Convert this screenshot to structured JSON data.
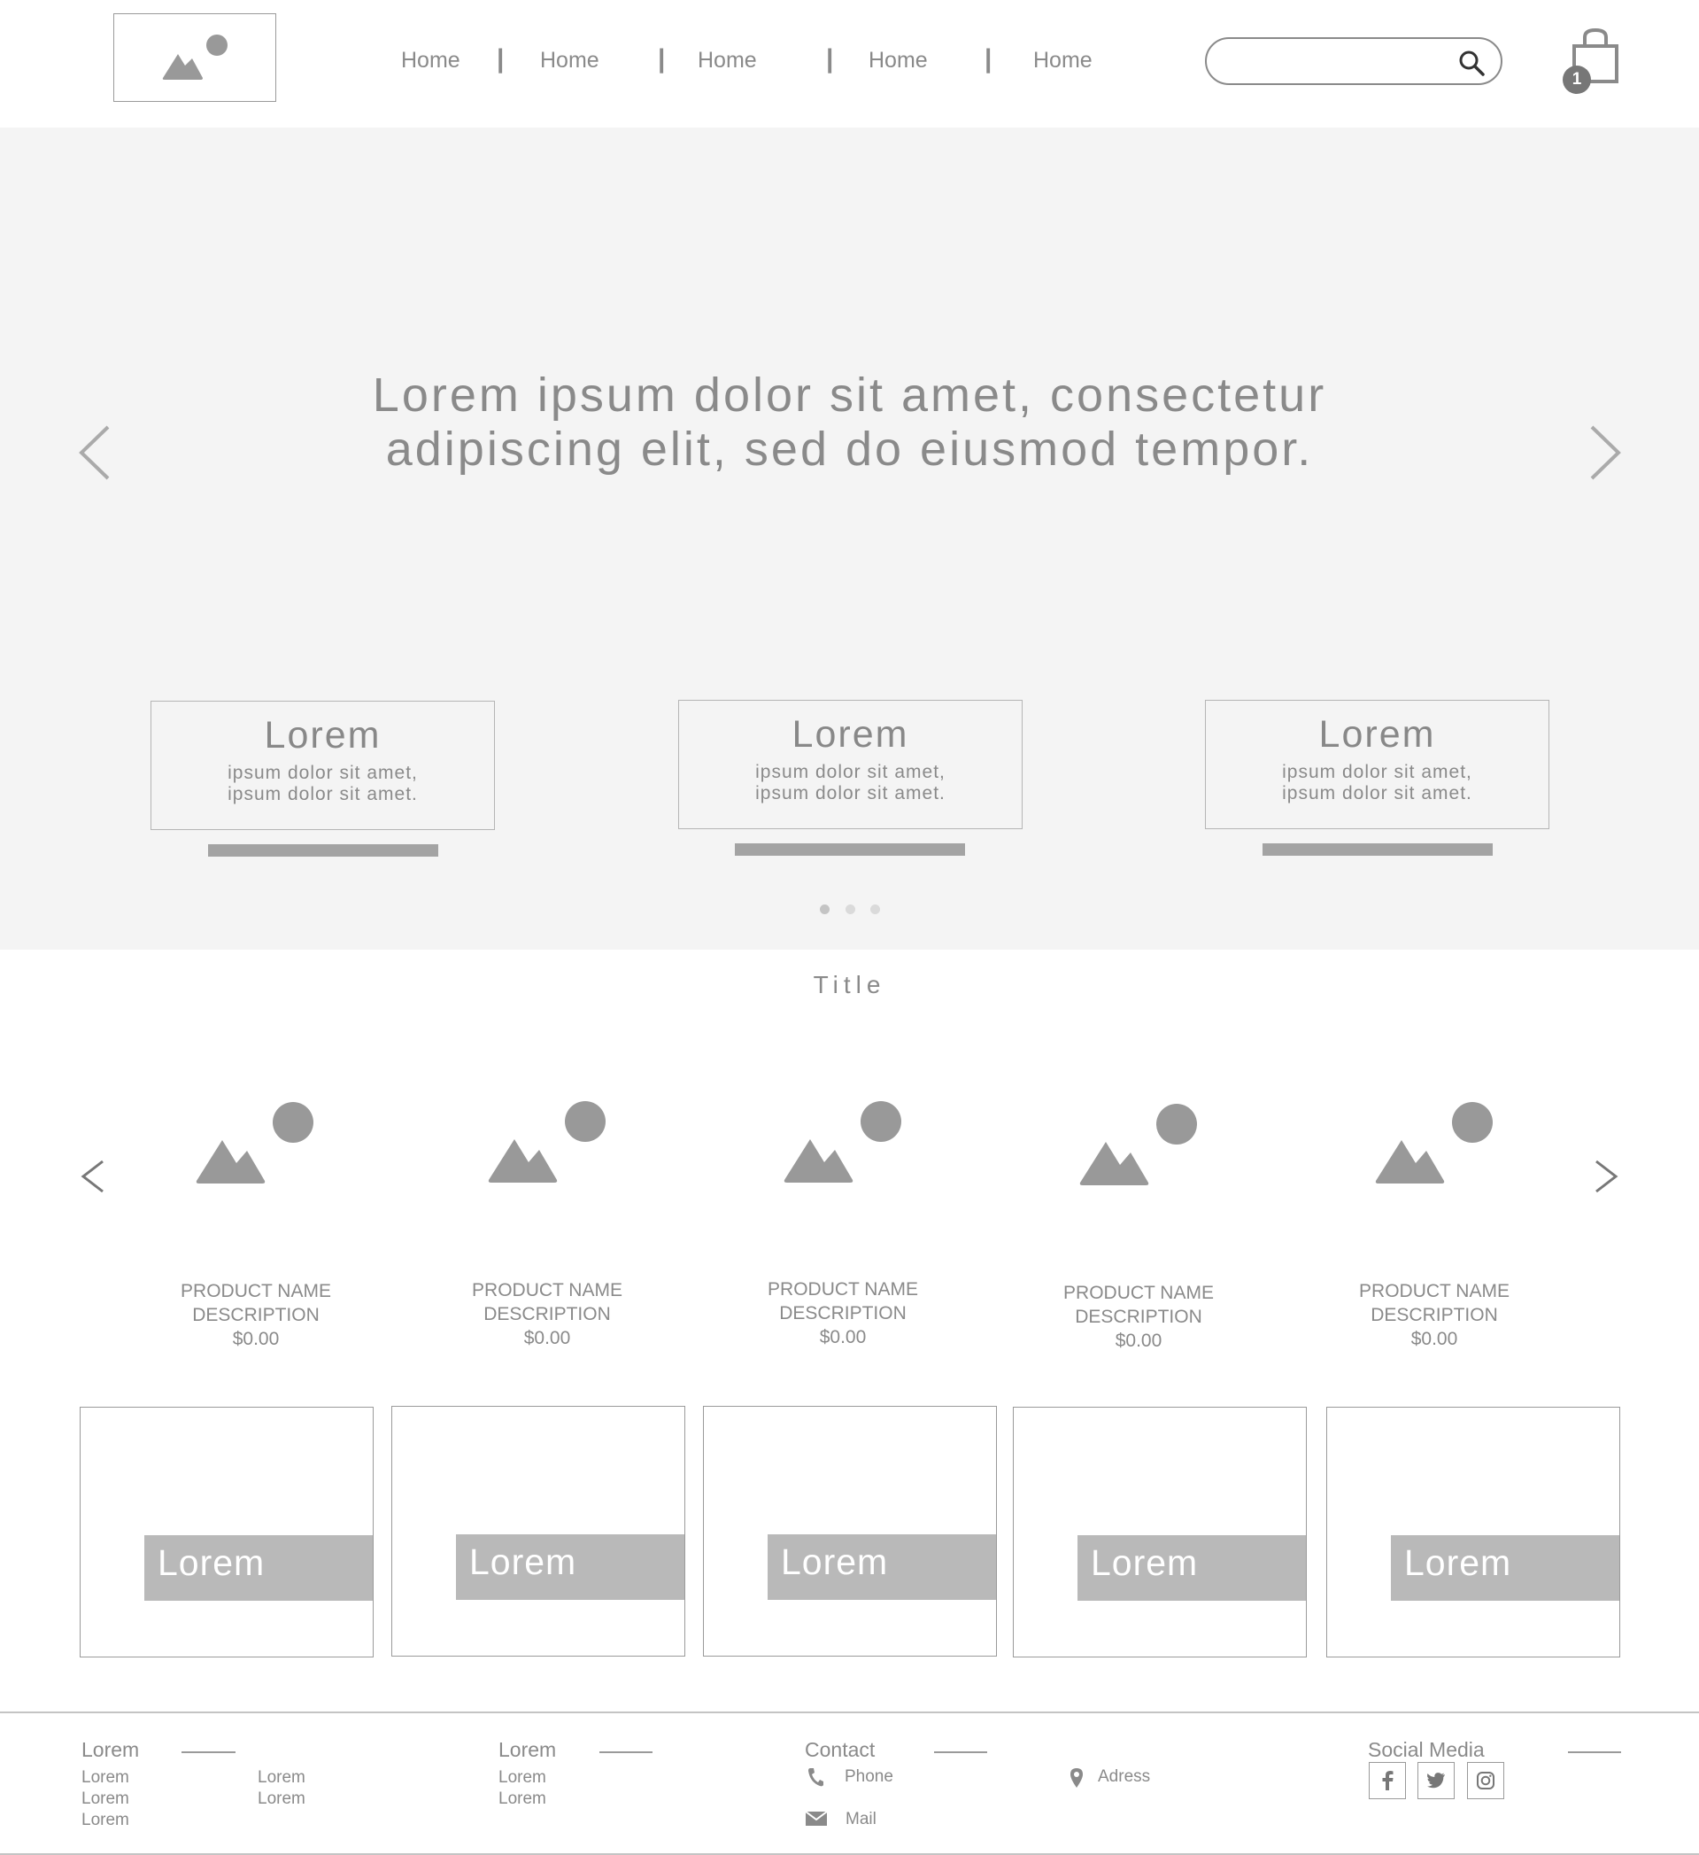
{
  "header": {
    "nav": [
      "Home",
      "Home",
      "Home",
      "Home",
      "Home"
    ],
    "separator": "|",
    "search": {
      "placeholder": ""
    },
    "cart": {
      "count": "1"
    }
  },
  "hero": {
    "headline_line1": "Lorem ipsum dolor sit amet, consectetur",
    "headline_line2": "adipiscing elit, sed do eiusmod tempor.",
    "cards": [
      {
        "title": "Lorem",
        "line1": "ipsum dolor sit amet,",
        "line2": "ipsum dolor sit amet."
      },
      {
        "title": "Lorem",
        "line1": "ipsum dolor sit amet,",
        "line2": "ipsum dolor sit amet."
      },
      {
        "title": "Lorem",
        "line1": "ipsum dolor sit amet,",
        "line2": "ipsum dolor sit amet."
      }
    ],
    "dots": {
      "count": 3,
      "active": 0
    }
  },
  "products": {
    "title": "Title",
    "items": [
      {
        "name": "PRODUCT NAME",
        "desc": "DESCRIPTION",
        "price": "$0.00"
      },
      {
        "name": "PRODUCT NAME",
        "desc": "DESCRIPTION",
        "price": "$0.00"
      },
      {
        "name": "PRODUCT NAME",
        "desc": "DESCRIPTION",
        "price": "$0.00"
      },
      {
        "name": "PRODUCT NAME",
        "desc": "DESCRIPTION",
        "price": "$0.00"
      },
      {
        "name": "PRODUCT NAME",
        "desc": "DESCRIPTION",
        "price": "$0.00"
      }
    ]
  },
  "tiles": [
    "Lorem",
    "Lorem",
    "Lorem",
    "Lorem",
    "Lorem"
  ],
  "footer": {
    "col1": {
      "heading": "Lorem",
      "links_a": [
        "Lorem",
        "Lorem",
        "Lorem"
      ],
      "links_b": [
        "Lorem",
        "Lorem"
      ]
    },
    "col2": {
      "heading": "Lorem",
      "links": [
        "Lorem",
        "Lorem"
      ]
    },
    "contact": {
      "heading": "Contact",
      "phone": "Phone",
      "mail": "Mail",
      "address": "Adress"
    },
    "social": {
      "heading": "Social Media",
      "icons": [
        "facebook-icon",
        "twitter-icon",
        "instagram-icon"
      ]
    }
  },
  "colors": {
    "placeholder_gray": "#999999",
    "hero_bg": "#f4f4f4",
    "tile_label_bg": "#b9b9b9"
  }
}
